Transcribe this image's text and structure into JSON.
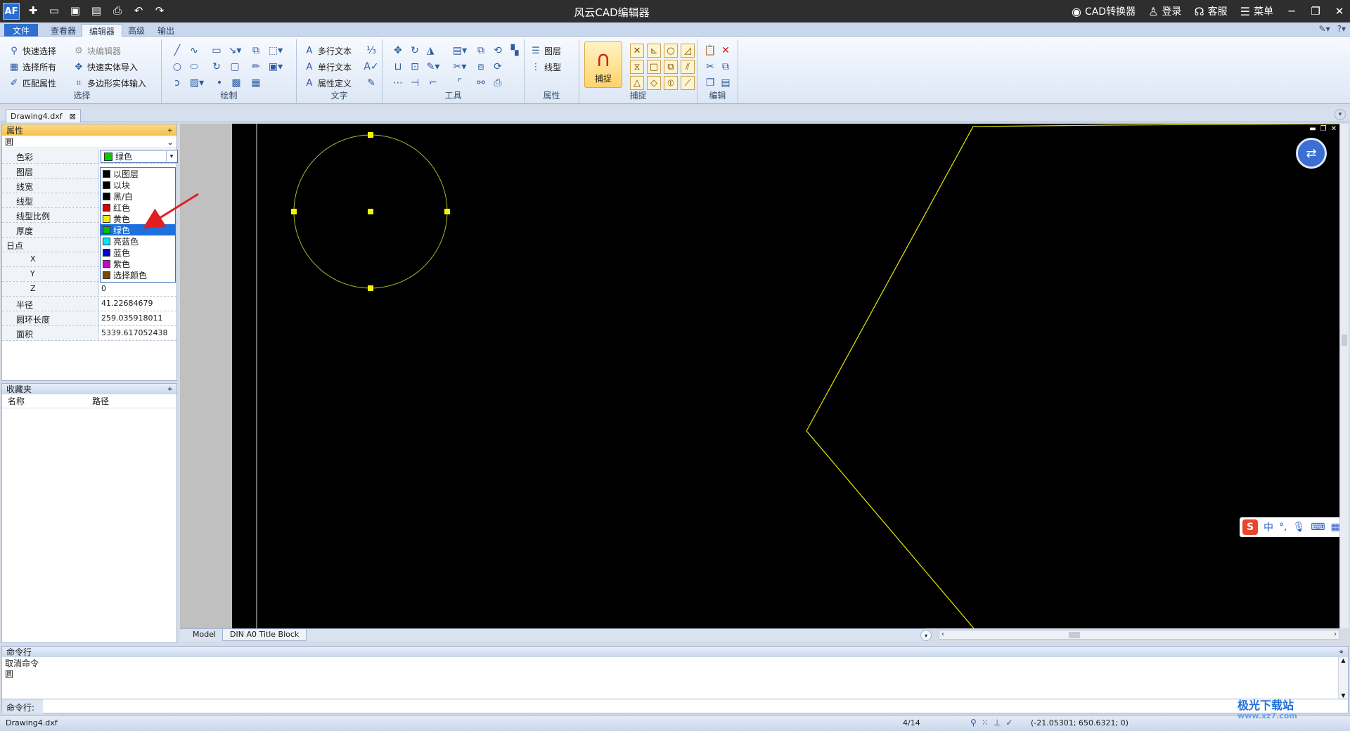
{
  "app": {
    "title": "风云CAD编辑器",
    "actions": [
      {
        "label": "CAD转换器",
        "icon": "cad-converter-icon"
      },
      {
        "label": "登录",
        "icon": "user-icon"
      },
      {
        "label": "客服",
        "icon": "headset-icon"
      },
      {
        "label": "菜单",
        "icon": "menu-icon"
      }
    ],
    "logo": "AF"
  },
  "ribbon_tabs": [
    "文件",
    "查看器",
    "编辑器",
    "高级",
    "输出"
  ],
  "active_tab": "编辑器",
  "ribbon": {
    "select": {
      "title": "选择",
      "buttons": [
        "快速选择",
        "选择所有",
        "匹配属性",
        "块编辑器",
        "快速实体导入",
        "多边形实体输入"
      ]
    },
    "draw": {
      "title": "绘制"
    },
    "text": {
      "title": "文字",
      "buttons": [
        "多行文本",
        "单行文本",
        "属性定义"
      ]
    },
    "tools": {
      "title": "工具"
    },
    "props": {
      "title": "属性",
      "buttons": [
        "图层",
        "线型"
      ]
    },
    "snap": {
      "title": "捕捉",
      "big_button": "捕捉"
    },
    "edit": {
      "title": "编辑"
    }
  },
  "document_tab": "Drawing4.dxf",
  "properties_panel": {
    "title": "属性",
    "object_type": "圆",
    "rows": {
      "color": {
        "name": "色彩",
        "value": "绿色",
        "swatch": "#00d000"
      },
      "layer": {
        "name": "图层"
      },
      "lineweight": {
        "name": "线宽"
      },
      "linetype": {
        "name": "线型"
      },
      "ltscale": {
        "name": "线型比例"
      },
      "thickness": {
        "name": "厚度"
      },
      "point": {
        "name": "日点"
      },
      "x": {
        "name": "X"
      },
      "y": {
        "name": "Y"
      },
      "z": {
        "name": "Z",
        "value": "0"
      },
      "radius": {
        "name": "半径",
        "value": "41.22684679"
      },
      "circumference": {
        "name": "圆环长度",
        "value": "259.035918011"
      },
      "area": {
        "name": "面积",
        "value": "5339.617052438"
      }
    },
    "color_options": [
      {
        "label": "以图层",
        "swatch": "#000000"
      },
      {
        "label": "以块",
        "swatch": "#000000"
      },
      {
        "label": "黑/白",
        "swatch": "#000000"
      },
      {
        "label": "红色",
        "swatch": "#e00000"
      },
      {
        "label": "黄色",
        "swatch": "#f0f000"
      },
      {
        "label": "绿色",
        "swatch": "#00c000"
      },
      {
        "label": "亮蓝色",
        "swatch": "#00e8f0"
      },
      {
        "label": "蓝色",
        "swatch": "#0000d0"
      },
      {
        "label": "紫色",
        "swatch": "#d000d0"
      },
      {
        "label": "选择颜色",
        "swatch": "#7a4a00"
      }
    ],
    "selected_color": "绿色"
  },
  "favorites_panel": {
    "title": "收藏夹",
    "columns": [
      "名称",
      "路径"
    ]
  },
  "layout_tabs": [
    "Model",
    "DIN A0 Title Block"
  ],
  "command_panel": {
    "title": "命令行",
    "log": [
      "取消命令",
      "圆"
    ],
    "input_label": "命令行:",
    "input_value": ""
  },
  "status": {
    "file": "Drawing4.dxf",
    "page": "4/14",
    "coords": "(-21.05301; 650.6321; 0)"
  },
  "ime": {
    "mode": "中"
  },
  "watermark": {
    "title": "极光下载站",
    "url": "www.xz7.com"
  },
  "colors": {
    "canvas": "#000000",
    "circle": "#b8b82a",
    "polyline": "#e8e800",
    "grip": "#f5f500",
    "accent": "#2f6fcf"
  }
}
